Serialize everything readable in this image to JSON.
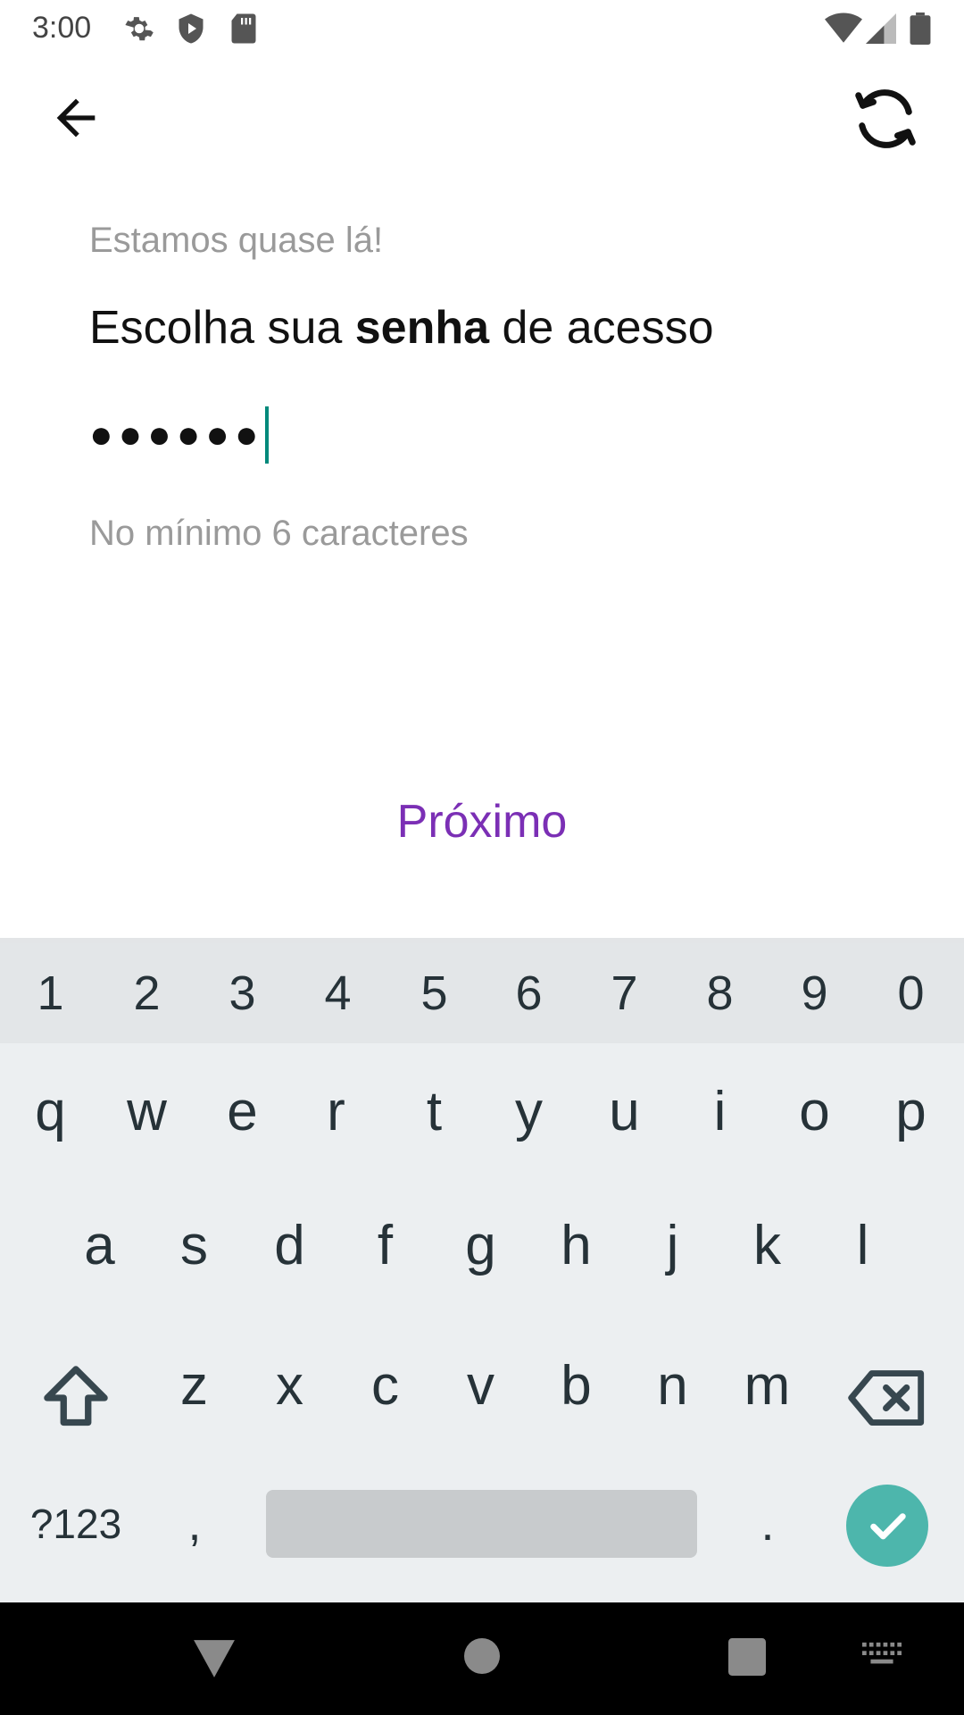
{
  "status_bar": {
    "time": "3:00",
    "left_icons": [
      "gear-icon",
      "shield-play-icon",
      "sd-card-icon"
    ],
    "right_icons": [
      "wifi-icon",
      "signal-icon",
      "battery-icon"
    ]
  },
  "app_bar": {
    "back_icon": "arrow-back-icon",
    "refresh_icon": "sync-icon"
  },
  "content": {
    "subtitle": "Estamos quase lá!",
    "title_prefix": "Escolha sua ",
    "title_bold": "senha",
    "title_suffix": " de acesso",
    "password_masked": "●●●●●●",
    "hint": "No mínimo 6 caracteres",
    "next_button": "Próximo"
  },
  "colors": {
    "accent": "#7b2fb5",
    "caret": "#00897b",
    "enter_key": "#4db6ac"
  },
  "keyboard": {
    "number_row": [
      "1",
      "2",
      "3",
      "4",
      "5",
      "6",
      "7",
      "8",
      "9",
      "0"
    ],
    "row1": [
      "q",
      "w",
      "e",
      "r",
      "t",
      "y",
      "u",
      "i",
      "o",
      "p"
    ],
    "row2": [
      "a",
      "s",
      "d",
      "f",
      "g",
      "h",
      "j",
      "k",
      "l"
    ],
    "row3": [
      "z",
      "x",
      "c",
      "v",
      "b",
      "n",
      "m"
    ],
    "symbols_key": "?123",
    "comma_key": ",",
    "period_key": ".",
    "shift_icon": "shift-icon",
    "backspace_icon": "backspace-icon",
    "enter_icon": "check-icon"
  },
  "nav_bar": {
    "icons": [
      "back-triangle-icon",
      "home-circle-icon",
      "recents-square-icon",
      "keyboard-switch-icon"
    ]
  }
}
